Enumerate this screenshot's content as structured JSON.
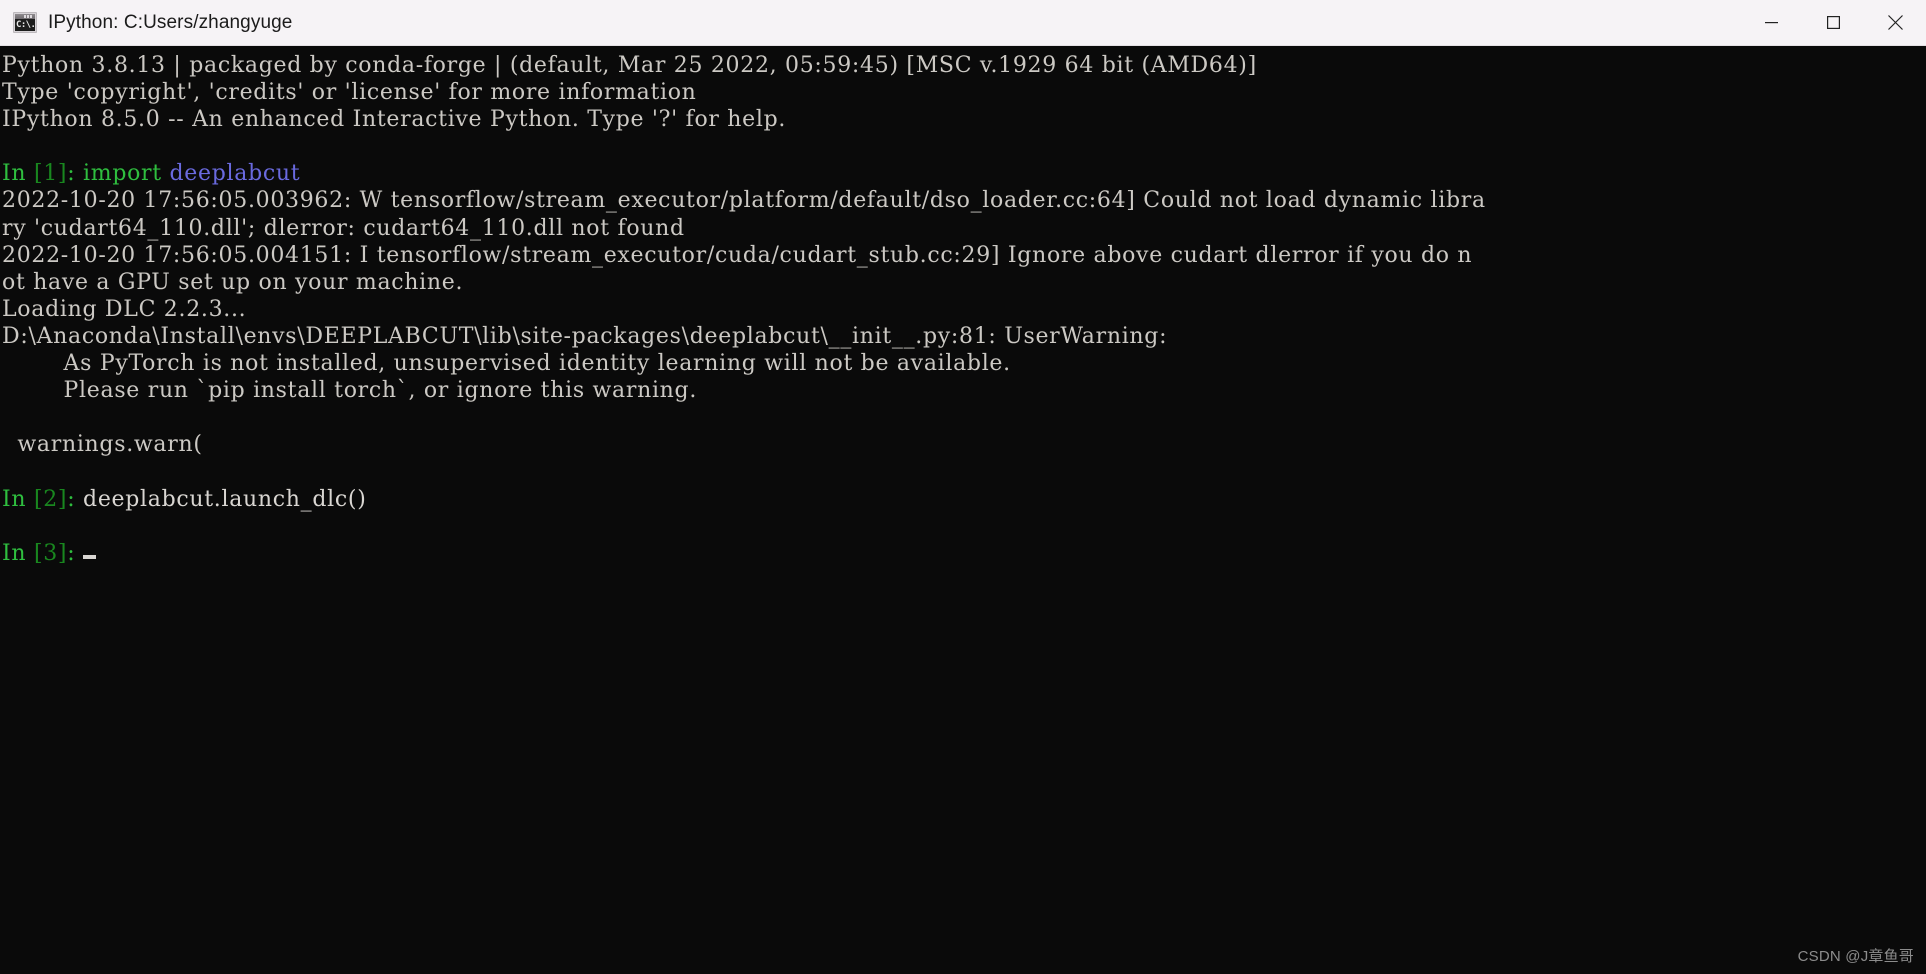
{
  "window": {
    "title": "IPython: C:Users/zhangyuge",
    "icon": "command-prompt-icon",
    "icon_glyph": "C:\\.",
    "controls": {
      "minimize": "minimize-icon",
      "maximize": "maximize-icon",
      "close": "close-icon"
    }
  },
  "terminal": {
    "background": "#0a0a0a",
    "foreground": "#ccc9c4",
    "prompt_color": "#2fbf3f",
    "module_color": "#6a6adf",
    "lines": [
      {
        "id": "banner-1",
        "text": "Python 3.8.13 | packaged by conda-forge | (default, Mar 25 2022, 05:59:45) [MSC v.1929 64 bit (AMD64)]"
      },
      {
        "id": "banner-2",
        "text": "Type 'copyright', 'credits' or 'license' for more information"
      },
      {
        "id": "banner-3",
        "text": "IPython 8.5.0 -- An enhanced Interactive Python. Type '?' for help."
      },
      {
        "id": "blank-1",
        "text": ""
      },
      {
        "id": "prompt-1",
        "type": "prompt",
        "prompt_in": "In ",
        "prompt_num": "[1]",
        "prompt_colon": ": ",
        "code_keyword": "import ",
        "code_module": "deeplabcut"
      },
      {
        "id": "tf-warn-1a",
        "text": "2022-10-20 17:56:05.003962: W tensorflow/stream_executor/platform/default/dso_loader.cc:64] Could not load dynamic libra"
      },
      {
        "id": "tf-warn-1b",
        "text": "ry 'cudart64_110.dll'; dlerror: cudart64_110.dll not found"
      },
      {
        "id": "tf-warn-2a",
        "text": "2022-10-20 17:56:05.004151: I tensorflow/stream_executor/cuda/cudart_stub.cc:29] Ignore above cudart dlerror if you do n"
      },
      {
        "id": "tf-warn-2b",
        "text": "ot have a GPU set up on your machine."
      },
      {
        "id": "loading",
        "text": "Loading DLC 2.2.3..."
      },
      {
        "id": "userwarning-path",
        "text": "D:\\Anaconda\\Install\\envs\\DEEPLABCUT\\lib\\site-packages\\deeplabcut\\__init__.py:81: UserWarning:"
      },
      {
        "id": "userwarning-body-1",
        "text": "        As PyTorch is not installed, unsupervised identity learning will not be available."
      },
      {
        "id": "userwarning-body-2",
        "text": "        Please run `pip install torch`, or ignore this warning."
      },
      {
        "id": "blank-2",
        "text": ""
      },
      {
        "id": "warnings-warn",
        "text": "  warnings.warn("
      },
      {
        "id": "blank-3",
        "text": ""
      },
      {
        "id": "prompt-2",
        "type": "prompt",
        "prompt_in": "In ",
        "prompt_num": "[2]",
        "prompt_colon": ": ",
        "code_plain": "deeplabcut.launch_dlc()"
      },
      {
        "id": "blank-4",
        "text": ""
      },
      {
        "id": "prompt-3",
        "type": "prompt",
        "prompt_in": "In ",
        "prompt_num": "[3]",
        "prompt_colon": ": ",
        "cursor": true
      }
    ]
  },
  "watermark": {
    "text": "CSDN @J章鱼哥"
  }
}
